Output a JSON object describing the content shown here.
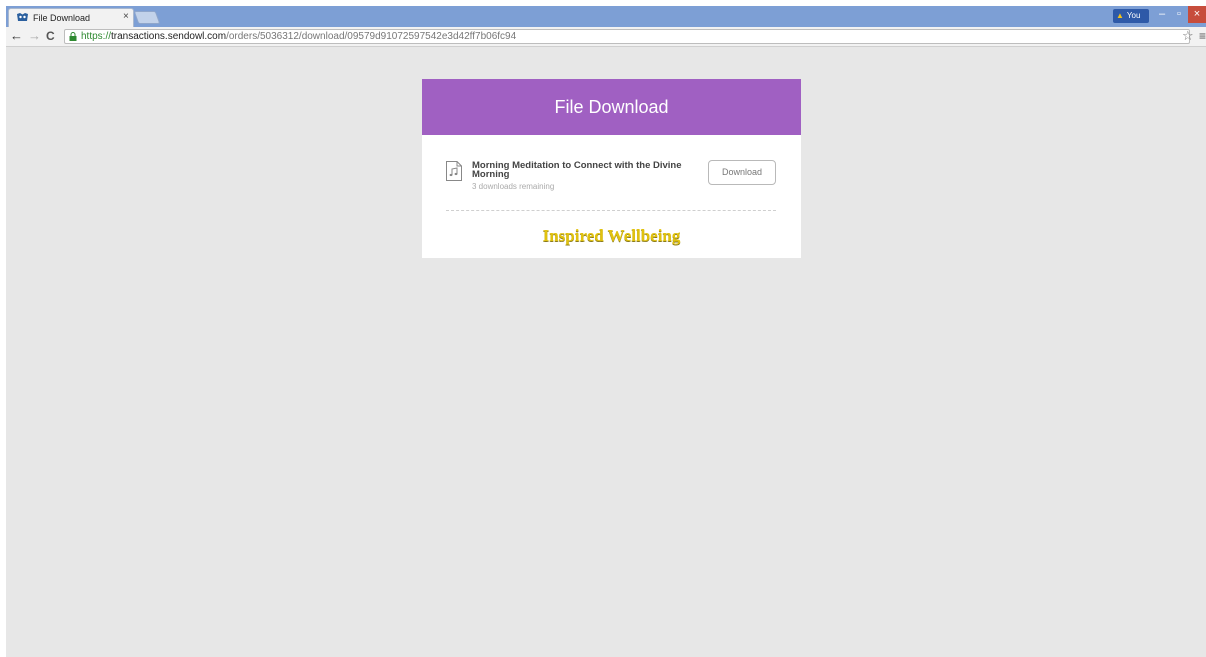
{
  "browser": {
    "tab_title": "File Download",
    "tab_close": "×",
    "user_label": "You",
    "url_scheme": "https://",
    "url_host": "transactions.sendowl.com",
    "url_path": "/orders/5036312/download/09579d91072597542e3d42ff7b06fc94",
    "icons": {
      "back": "back-arrow-icon",
      "forward": "forward-arrow-icon",
      "reload": "reload-icon",
      "lock": "lock-icon",
      "star": "star-icon",
      "menu": "menu-icon"
    },
    "colors": {
      "tabstrip": "#7d9fd5",
      "close": "#c74d3c",
      "secure": "#2f8a31"
    }
  },
  "page": {
    "header_title": "File Download",
    "file": {
      "name": "Morning Meditation to Connect with the Divine Morning",
      "remaining": "3 downloads remaining",
      "icon": "audio-file-icon"
    },
    "download_label": "Download",
    "brand_name": "Inspired Wellbeing",
    "colors": {
      "header": "#a060c2",
      "brand": "#e1c20e",
      "background": "#e7e7e7"
    }
  }
}
